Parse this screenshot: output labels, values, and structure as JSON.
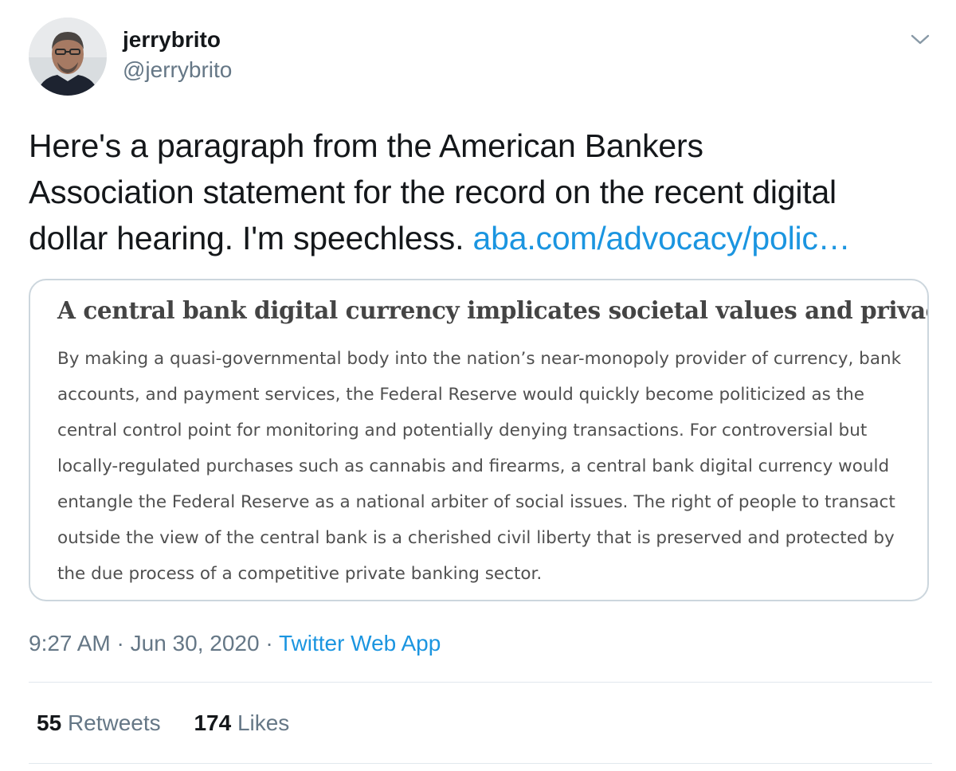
{
  "author": {
    "display_name": "jerrybrito",
    "handle": "@jerrybrito",
    "avatar_icon": "profile-photo"
  },
  "tweet": {
    "text_lines": [
      "Here's a paragraph from the American Bankers",
      "Association statement for the record on the recent digital",
      "dollar hearing. I'm speechless."
    ],
    "link_text": "aba.com/advocacy/polic…"
  },
  "media": {
    "heading": "A central bank digital currency implicates societal values and privacy.",
    "body_lines": [
      "By making a quasi-governmental body into the nation’s near-monopoly provider of currency, bank",
      "accounts, and payment services, the Federal Reserve would quickly become politicized as the",
      "central control point for monitoring and potentially denying transactions. For controversial but",
      "locally-regulated purchases such as cannabis and firearms, a central bank digital currency would",
      "entangle the Federal Reserve as a national arbiter of social issues. The right of people to transact",
      "outside the view of the central bank is a cherished civil liberty that is preserved and protected by",
      "the due process of a competitive private banking sector."
    ]
  },
  "meta": {
    "time": "9:27 AM",
    "separator": " · ",
    "date": "Jun 30, 2020",
    "source": "Twitter Web App"
  },
  "stats": {
    "retweets_count": "55",
    "retweets_label": "Retweets",
    "likes_count": "174",
    "likes_label": "Likes"
  },
  "colors": {
    "link_blue": "#1b95e0",
    "secondary_gray": "#657786",
    "border_gray": "#ccd6dd"
  }
}
